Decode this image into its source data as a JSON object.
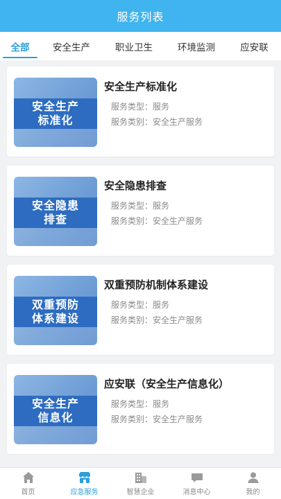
{
  "header": {
    "title": "服务列表"
  },
  "tabs": [
    {
      "label": "全部",
      "active": true
    },
    {
      "label": "安全生产",
      "active": false
    },
    {
      "label": "职业卫生",
      "active": false
    },
    {
      "label": "环境监测",
      "active": false
    },
    {
      "label": "应安联",
      "active": false
    }
  ],
  "services": [
    {
      "thumb_line1": "安全生产",
      "thumb_line2": "标准化",
      "title": "安全生产标准化",
      "type": "服务类型：服务",
      "category": "服务类别：安全生产服务"
    },
    {
      "thumb_line1": "安全隐患",
      "thumb_line2": "排查",
      "title": "安全隐患排查",
      "type": "服务类型：服务",
      "category": "服务类别：安全生产服务"
    },
    {
      "thumb_line1": "双重预防",
      "thumb_line2": "体系建设",
      "title": "双重预防机制体系建设",
      "type": "服务类型：服务",
      "category": "服务类别：安全生产服务"
    },
    {
      "thumb_line1": "安全生产",
      "thumb_line2": "信息化",
      "title": "应安联（安全生产信息化）",
      "type": "服务类型：服务",
      "category": "服务类别：安全生产服务"
    }
  ],
  "bottom_nav": [
    {
      "label": "首页",
      "icon": "home-icon",
      "active": false
    },
    {
      "label": "应急服务",
      "icon": "shop-icon",
      "active": true
    },
    {
      "label": "智慧企业",
      "icon": "building-icon",
      "active": false
    },
    {
      "label": "消息中心",
      "icon": "message-icon",
      "active": false
    },
    {
      "label": "我的",
      "icon": "user-icon",
      "active": false
    }
  ],
  "colors": {
    "header_bg": "#3fb4ee",
    "accent": "#2b9fd9",
    "thumb_band": "#2d6cc0"
  }
}
